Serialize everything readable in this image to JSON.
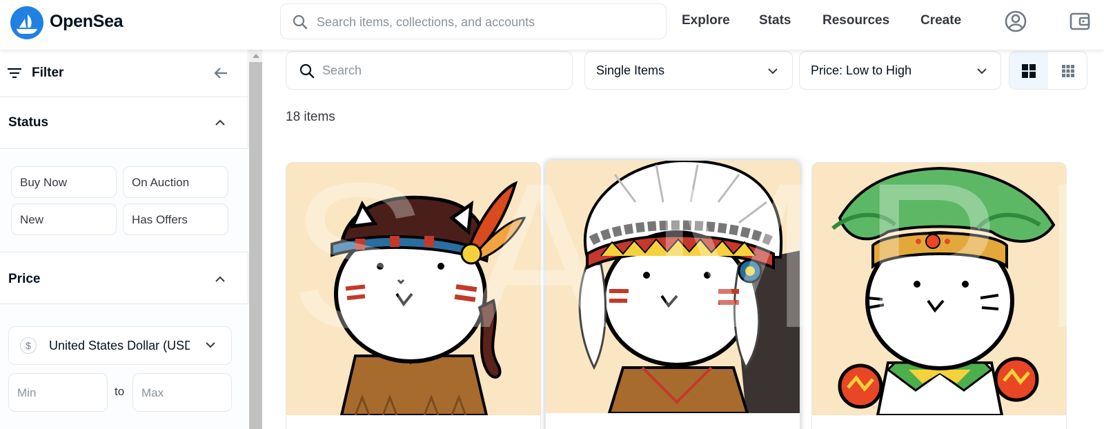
{
  "brand": {
    "name": "OpenSea",
    "color": "#2081e2"
  },
  "header": {
    "search_placeholder": "Search items, collections, and accounts",
    "nav": {
      "explore": "Explore",
      "stats": "Stats",
      "resources": "Resources",
      "create": "Create"
    },
    "icons": [
      "search-icon",
      "account-icon",
      "wallet-icon"
    ]
  },
  "sidebar": {
    "title": "Filter",
    "status": {
      "title": "Status",
      "chips": [
        "Buy Now",
        "On Auction",
        "New",
        "Has Offers"
      ]
    },
    "price": {
      "title": "Price",
      "currency": "United States Dollar (USD)",
      "min_placeholder": "Min",
      "max_placeholder": "Max",
      "to_label": "to"
    }
  },
  "main": {
    "search_placeholder": "Search",
    "item_filter": "Single Items",
    "sort": "Price: Low to High",
    "view_modes": [
      "large-grid",
      "small-grid"
    ],
    "active_view": "large-grid",
    "count_label": "18 items"
  },
  "cards": [
    {
      "name": "cat-with-feather-headband",
      "skin": "#ffffff",
      "outfit": "#a76b2e"
    },
    {
      "name": "cat-with-feather-headdress",
      "skin": "#ffffff",
      "outfit": "#a76b2e"
    },
    {
      "name": "cat-with-palm-headdress",
      "skin": "#ffffff",
      "outfit": "#ffffff"
    }
  ],
  "watermark": "SAMPLE",
  "colors": {
    "card_bg": "#fae6c2",
    "accent": "#2081e2",
    "text": "#04111d"
  }
}
